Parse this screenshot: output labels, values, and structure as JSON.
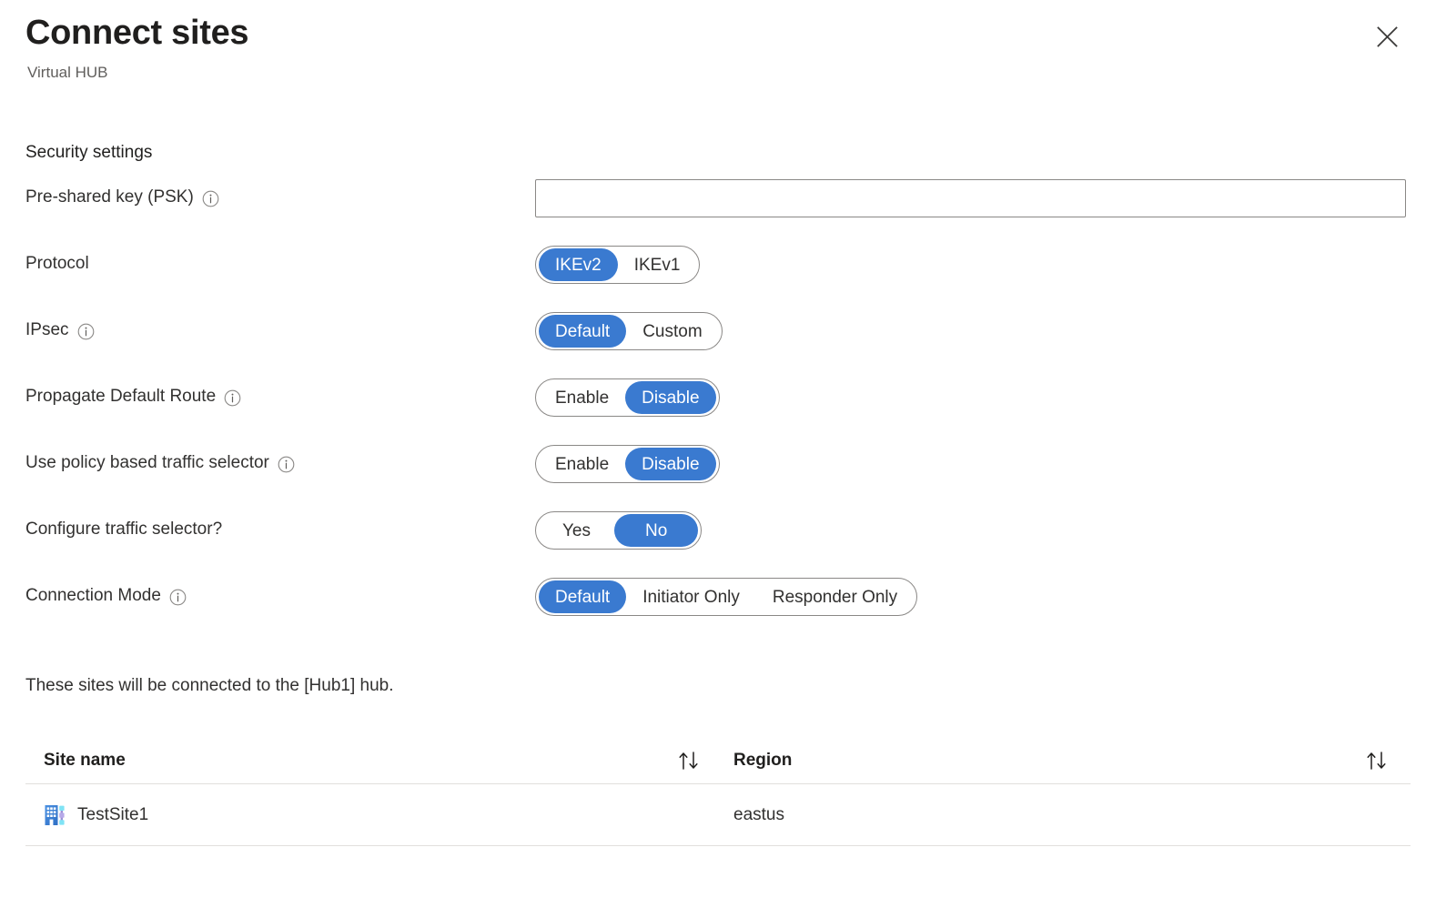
{
  "header": {
    "title": "Connect sites",
    "subtitle": "Virtual HUB",
    "close_label": "Close",
    "close_icon": "close-icon"
  },
  "section": {
    "title": "Security settings"
  },
  "form": {
    "psk": {
      "label": "Pre-shared key (PSK)",
      "value": "",
      "placeholder": "",
      "has_info": true,
      "info_icon": "info-icon"
    },
    "protocol": {
      "label": "Protocol",
      "has_info": false,
      "options": [
        "IKEv2",
        "IKEv1"
      ],
      "selected": "IKEv2"
    },
    "ipsec": {
      "label": "IPsec",
      "has_info": true,
      "options": [
        "Default",
        "Custom"
      ],
      "selected": "Default"
    },
    "propagate_default_route": {
      "label": "Propagate Default Route",
      "has_info": true,
      "options": [
        "Enable",
        "Disable"
      ],
      "selected": "Disable"
    },
    "policy_based_traffic_selector": {
      "label": "Use policy based traffic selector",
      "has_info": true,
      "options": [
        "Enable",
        "Disable"
      ],
      "selected": "Disable"
    },
    "configure_traffic_selector": {
      "label": "Configure traffic selector?",
      "has_info": false,
      "options": [
        "Yes",
        "No"
      ],
      "selected": "No"
    },
    "connection_mode": {
      "label": "Connection Mode",
      "has_info": true,
      "options": [
        "Default",
        "Initiator Only",
        "Responder Only"
      ],
      "selected": "Default"
    }
  },
  "note": {
    "text": "These sites will be connected to the [Hub1] hub."
  },
  "table": {
    "columns": [
      {
        "label": "Site name",
        "sortable": true,
        "sort_icon": "sort-arrows-icon"
      },
      {
        "label": "Region",
        "sortable": true,
        "sort_icon": "sort-arrows-icon"
      }
    ],
    "rows": [
      {
        "site_name": "TestSite1",
        "region": "eastus",
        "icon": "vpn-site-icon"
      }
    ]
  },
  "colors": {
    "accent_blue": "#3a7ad0",
    "text_primary": "#323130",
    "text_secondary": "#605e5c",
    "border": "#8a8886",
    "divider": "#e1dfdd",
    "site_icon_building": "#3c7fd4",
    "site_icon_connector": "#7fd8f0"
  }
}
